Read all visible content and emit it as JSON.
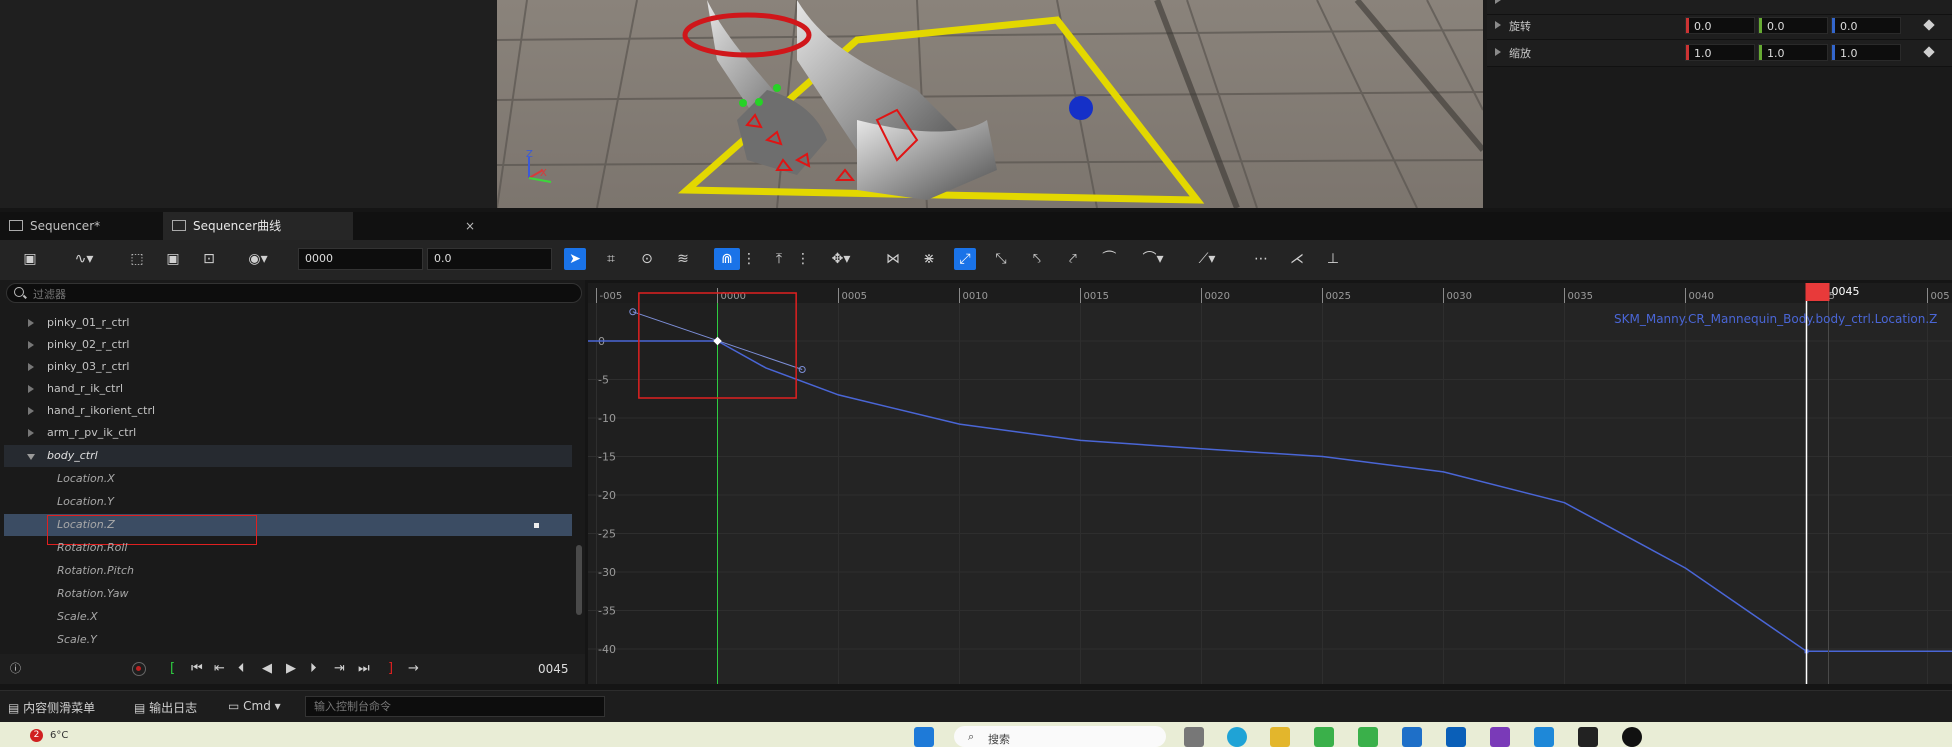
{
  "details": {
    "rows": [
      {
        "label": "旋转",
        "x": "0.0",
        "y": "0.0",
        "z": "0.0"
      },
      {
        "label": "缩放",
        "x": "1.0",
        "y": "1.0",
        "z": "1.0"
      }
    ]
  },
  "tabs": {
    "sequencer": "Sequencer*",
    "curves": "Sequencer曲线",
    "close": "×"
  },
  "toolbar": {
    "frame_value": "0000",
    "value_field": "0.0"
  },
  "tree": {
    "filter_placeholder": "过滤器",
    "items": [
      {
        "label": "pinky_01_r_ctrl"
      },
      {
        "label": "pinky_02_r_ctrl"
      },
      {
        "label": "pinky_03_r_ctrl"
      },
      {
        "label": "hand_r_ik_ctrl"
      },
      {
        "label": "hand_r_ikorient_ctrl"
      },
      {
        "label": "arm_r_pv_ik_ctrl"
      },
      {
        "label": "body_ctrl"
      },
      {
        "label": "Location.X"
      },
      {
        "label": "Location.Y"
      },
      {
        "label": "Location.Z"
      },
      {
        "label": "Rotation.Roll"
      },
      {
        "label": "Rotation.Pitch"
      },
      {
        "label": "Rotation.Yaw"
      },
      {
        "label": "Scale.X"
      },
      {
        "label": "Scale.Y"
      }
    ]
  },
  "transport": {
    "current_frame": "0045"
  },
  "graph": {
    "curve_name": "SKM_Manny.CR_Mannequin_Body.body_ctrl.Location.Z",
    "frame_ticks": [
      "-005",
      "0000",
      "0005",
      "0010",
      "0015",
      "0020",
      "0025",
      "0030",
      "0035",
      "0040",
      "0045",
      "005"
    ],
    "playhead_label": "0045",
    "value_ticks": [
      "0",
      "-5",
      "-10",
      "-15",
      "-20",
      "-25",
      "-30",
      "-35",
      "-40"
    ],
    "curve_color": "#4a66d6",
    "playhead_color": "#e83a3a"
  },
  "statusbar": {
    "content_drawer": "内容侧滑菜单",
    "output_log": "输出日志",
    "cmd": "Cmd",
    "cmd_placeholder": "输入控制台命令"
  },
  "taskbar": {
    "weather_badge": "2",
    "temperature": "6°C",
    "search": "搜索"
  }
}
